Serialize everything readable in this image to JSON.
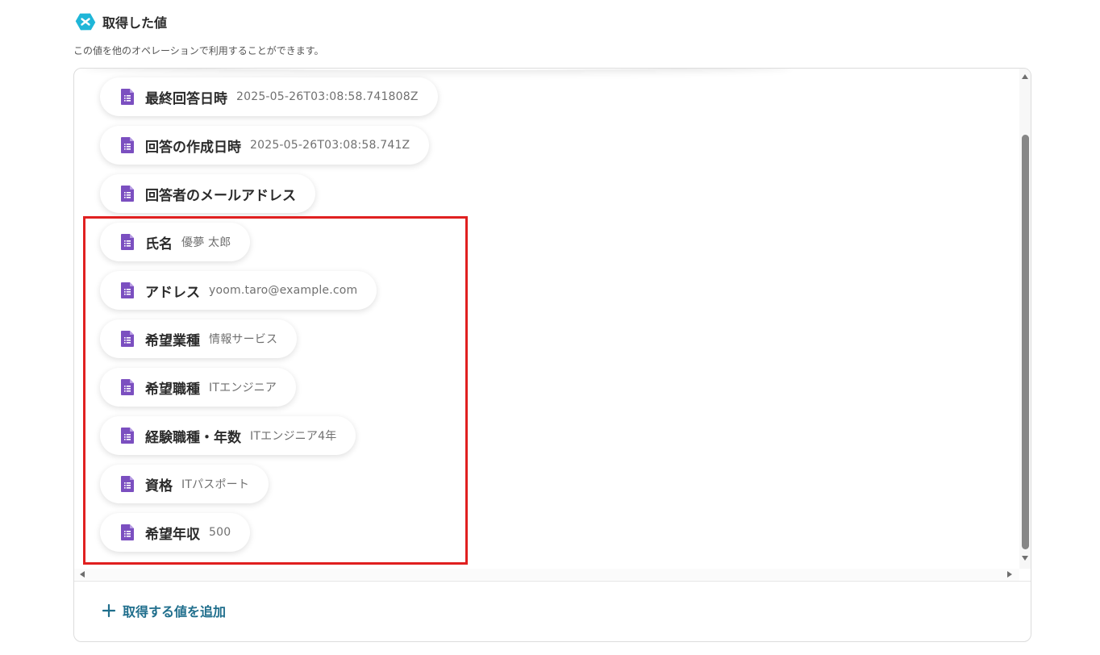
{
  "header": {
    "title": "取得した値",
    "description": "この値を他のオペレーションで利用することができます。"
  },
  "fields": [
    {
      "label": "最終回答日時",
      "value": "2025-05-26T03:08:58.741808Z"
    },
    {
      "label": "回答の作成日時",
      "value": "2025-05-26T03:08:58.741Z"
    },
    {
      "label": "回答者のメールアドレス",
      "value": ""
    },
    {
      "label": "氏名",
      "value": "優夢 太郎"
    },
    {
      "label": "アドレス",
      "value": "yoom.taro@example.com"
    },
    {
      "label": "希望業種",
      "value": "情報サービス"
    },
    {
      "label": "希望職種",
      "value": "ITエンジニア"
    },
    {
      "label": "経験職種・年数",
      "value": "ITエンジニア4年"
    },
    {
      "label": "資格",
      "value": "ITパスポート"
    },
    {
      "label": "希望年収",
      "value": "500"
    }
  ],
  "footer": {
    "add_label": "取得する値を追加"
  },
  "colors": {
    "logo": "#1fb6d8",
    "doc_icon": "#7b4fc0",
    "highlight": "#e02020",
    "add_text": "#1f6e8c"
  },
  "icons": {
    "logo": "yoom-logo-icon",
    "field": "google-forms-doc-icon",
    "add": "plus-icon"
  }
}
